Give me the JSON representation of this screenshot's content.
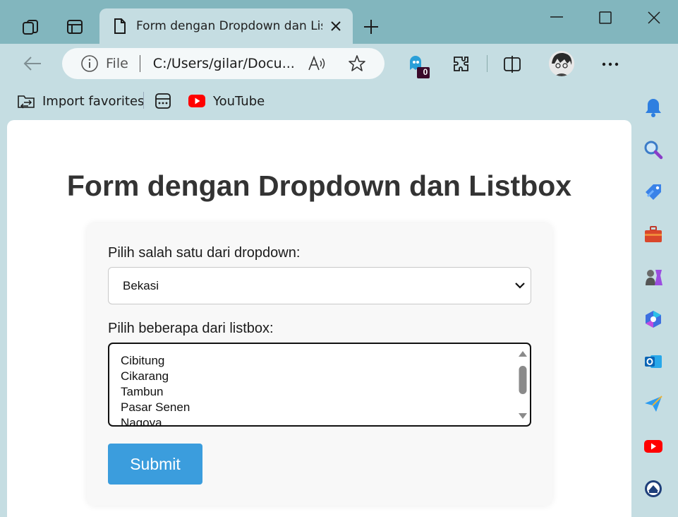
{
  "browser": {
    "tab": {
      "title": "Form dengan Dropdown dan Listbox"
    },
    "address": {
      "protocol": "File",
      "url": "C:/Users/gilar/Docu..."
    },
    "extension_badge": "0",
    "favorites": [
      {
        "label": "Import favorites",
        "icon": "folder-import-icon"
      },
      {
        "label": "",
        "icon": "app-grid-icon"
      },
      {
        "label": "YouTube",
        "icon": "youtube-icon"
      }
    ],
    "colors": {
      "titlebar": "#82b6be",
      "toolbar": "#c5dde2",
      "accent": "#3b9ddd"
    }
  },
  "page": {
    "title": "Form dengan Dropdown dan Listbox",
    "dropdown_label": "Pilih salah satu dari dropdown:",
    "dropdown_value": "Bekasi",
    "listbox_label": "Pilih beberapa dari listbox:",
    "listbox_options": [
      "Cibitung",
      "Cikarang",
      "Tambun",
      "Pasar Senen",
      "Nagoya"
    ],
    "submit_label": "Submit"
  },
  "sidebar_icons": [
    "bell-icon",
    "search-icon",
    "shopping-tag-icon",
    "toolbox-icon",
    "games-icon",
    "copilot-icon",
    "outlook-icon",
    "send-icon",
    "youtube-icon",
    "app-icon"
  ]
}
